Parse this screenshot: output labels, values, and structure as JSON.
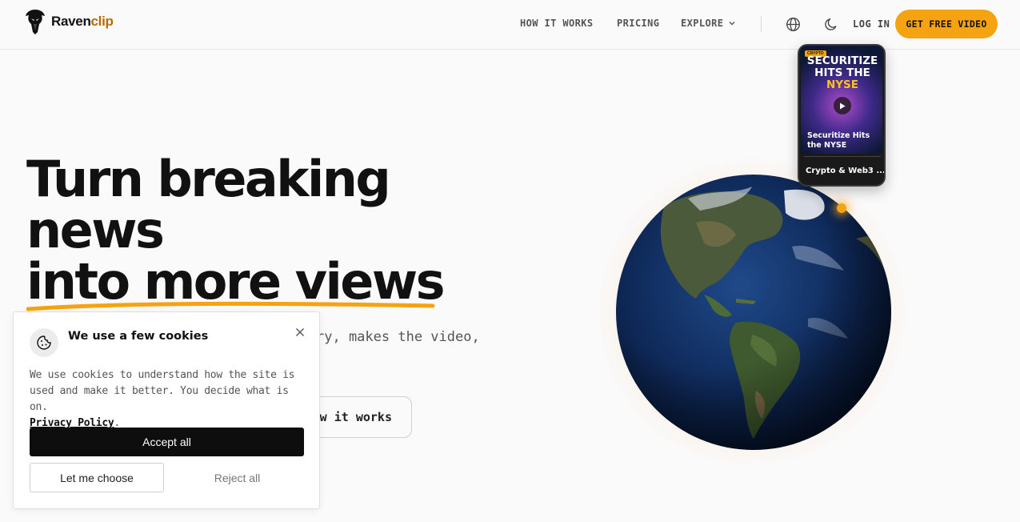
{
  "brand": {
    "name_primary": "Raven",
    "name_accent": "clip",
    "accent_color": "#f5a310"
  },
  "nav": {
    "how_it_works": "HOW IT WORKS",
    "pricing": "PRICING",
    "explore": "EXPLORE",
    "login": "LOG IN",
    "cta": "GET FREE VIDEO",
    "icons": [
      "globe-icon",
      "moon-icon",
      "chevron-down-icon"
    ]
  },
  "hero": {
    "title_line1": "Turn breaking",
    "title_line2": "news",
    "title_line3": "into more views",
    "subtitle_visible": "ry, makes the video,",
    "secondary_button": "ow it works"
  },
  "phone_card": {
    "badge": "CRYPTO",
    "headline_part1": "SECURITIZE HITS THE",
    "headline_highlight": "NYSE",
    "caption": "Securitize Hits the NYSE",
    "category": "Crypto & Web3 ..."
  },
  "cookie": {
    "title": "We use a few cookies",
    "body": "We use cookies to understand how the site is used and make it better. You decide what is on.",
    "privacy_link": "Privacy Policy",
    "privacy_suffix": ".",
    "accept_all": "Accept all",
    "let_me_choose": "Let me choose",
    "reject_all": "Reject all"
  }
}
